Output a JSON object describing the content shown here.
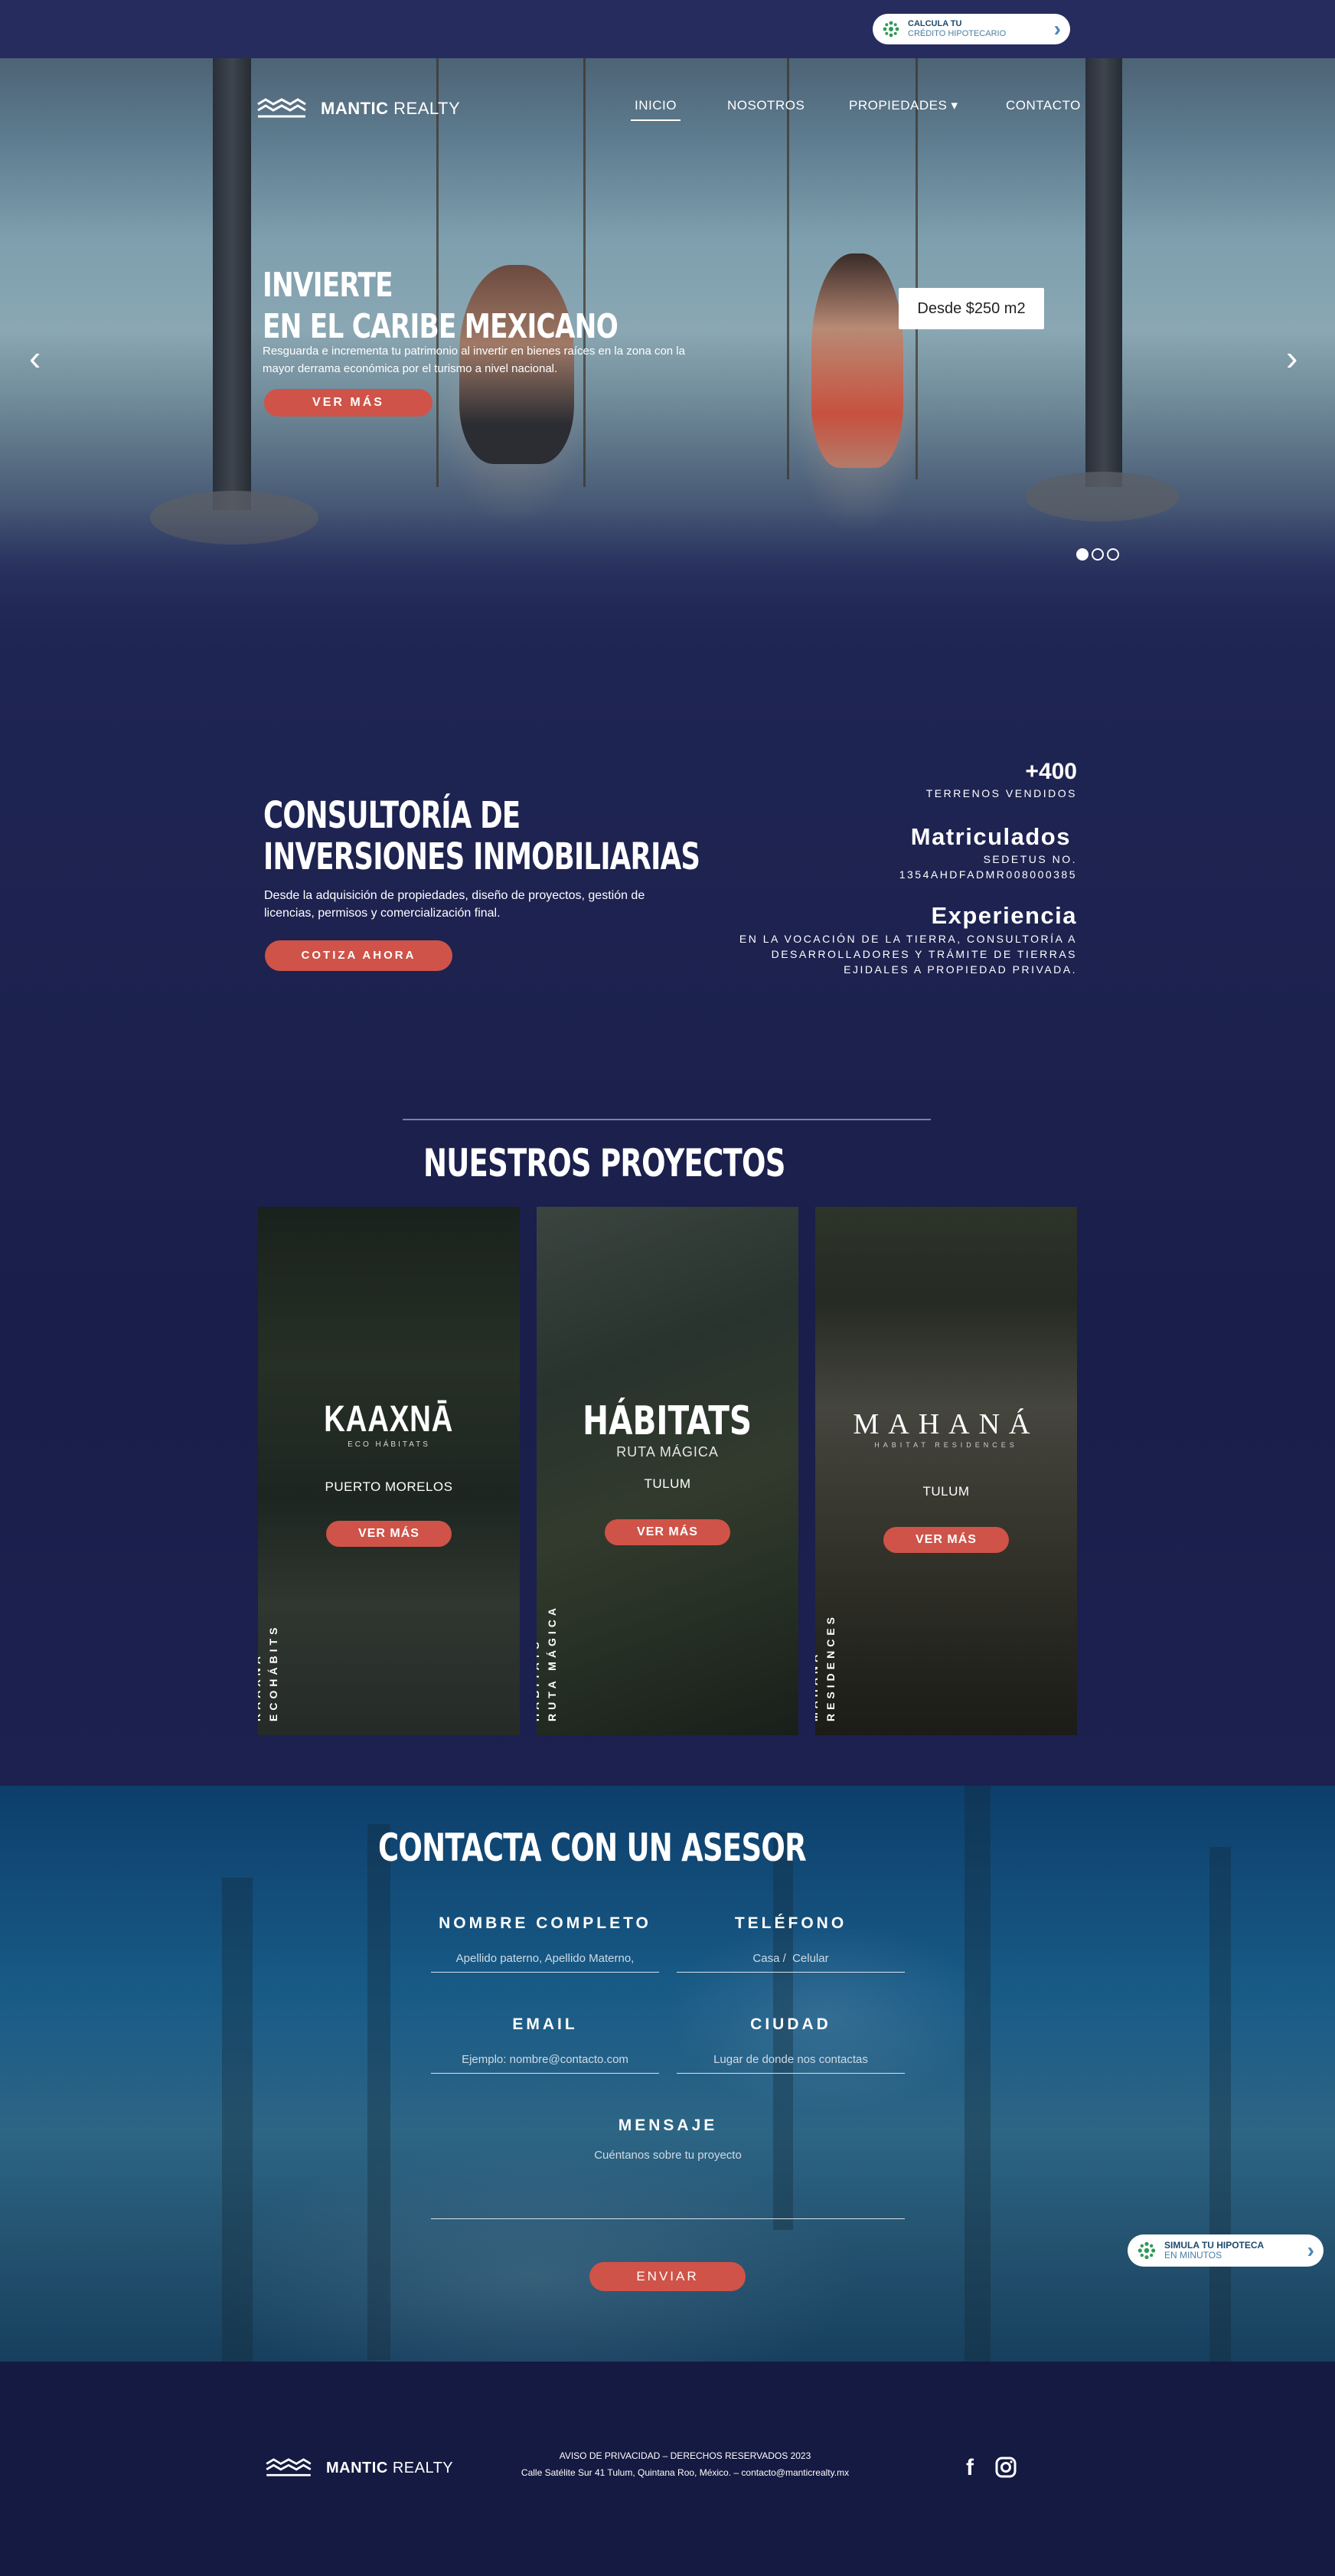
{
  "top_bar": {
    "calc": {
      "line1": "CALCULA TU",
      "line2": "CRÉDITO HIPOTECARIO",
      "icon": "network-icon",
      "arrow": "›"
    }
  },
  "brand": {
    "bold": "MANTIC",
    "rest": "REALTY"
  },
  "nav": {
    "items": [
      {
        "label": "INICIO",
        "active": true
      },
      {
        "label": "NOSOTROS"
      },
      {
        "label": "PROPIEDADES ▾"
      },
      {
        "label": "CONTACTO"
      }
    ]
  },
  "hero": {
    "title_line1": "INVIERTE",
    "title_line2": "EN EL CARIBE MEXICANO",
    "subtitle": "Resguarda e incrementa tu patrimonio al invertir en bienes raíces en la zona con la mayor derrama económica por el turismo a nivel nacional.",
    "cta": "VER MÁS",
    "price": "Desde $250 m2",
    "arrow_left": "‹",
    "arrow_right": "›",
    "slides_total": 3,
    "slide_active": 1
  },
  "consulting": {
    "title_line1": "CONSULTORÍA DE",
    "title_line2": "INVERSIONES INMOBILIARIAS",
    "subtitle": "Desde la adquisición de propiedades, diseño de proyectos, gestión de licencias, permisos y comercialización final.",
    "cta": "COTIZA AHORA",
    "stats": [
      {
        "big": "+400",
        "small": [
          "TERRENOS VENDIDOS"
        ]
      },
      {
        "big": "Matriculados",
        "small": [
          "SEDETUS NO.",
          "1354AHDFADMR008000385"
        ]
      },
      {
        "big": "Experiencia",
        "small": [
          "EN LA VOCACIÓN DE LA TIERRA, CONSULTORÍA A",
          "DESARROLLADORES Y TRÁMITE DE TIERRAS",
          "EJIDALES A PROPIEDAD PRIVADA."
        ]
      }
    ]
  },
  "projects": {
    "title": "NUESTROS PROYECTOS",
    "cards": [
      {
        "logo": "KAAXNĀ",
        "logo_sub": "ECO HÁBITATS",
        "location": "PUERTO MORELOS",
        "cta": "VER MÁS",
        "vertical1": "KAAXNÁ",
        "vertical2": "ECOHÁBITS"
      },
      {
        "logo": "HÁBITATS",
        "logo_sub": "RUTA MÁGICA",
        "location": "TULUM",
        "cta": "VER MÁS",
        "vertical1": "HÁBITATS",
        "vertical2": "RUTA MÁGICA"
      },
      {
        "logo": "MAHANÁ",
        "logo_sub": "HABITAT RESIDENCES",
        "location": "TULUM",
        "cta": "VER MÁS",
        "vertical1": "MAHANÁ",
        "vertical2": "RESIDENCES"
      }
    ]
  },
  "contact": {
    "title": "CONTACTA CON UN ASESOR",
    "fields": {
      "name": {
        "label": "NOMBRE COMPLETO",
        "placeholder": "Apellido paterno, Apellido Materno,"
      },
      "phone": {
        "label": "TELÉFONO",
        "placeholder": "Casa /  Celular"
      },
      "email": {
        "label": "EMAIL",
        "placeholder": "Ejemplo: nombre@contacto.com"
      },
      "city": {
        "label": "CIUDAD",
        "placeholder": "Lugar de donde nos contactas"
      },
      "message": {
        "label": "MENSAJE",
        "placeholder": "Cuéntanos sobre tu proyecto"
      }
    },
    "submit": "ENVIAR",
    "simula": {
      "line1": "SIMULA TU HIPOTECA",
      "line2": "EN MINUTOS",
      "icon": "network-icon",
      "arrow": "›"
    }
  },
  "footer": {
    "legal": "AVISO DE PRIVACIDAD – DERECHOS RESERVADOS 2023",
    "address": "Calle Satélite Sur 41 Tulum, Quintana Roo, México. – contacto@manticrealty.mx",
    "social": [
      {
        "icon": "facebook-icon",
        "glyph": "f"
      },
      {
        "icon": "instagram-icon"
      }
    ]
  },
  "colors": {
    "navy": "#1b1f4a",
    "accent_red": "#cf5348",
    "contact_blue": "#185a86"
  }
}
